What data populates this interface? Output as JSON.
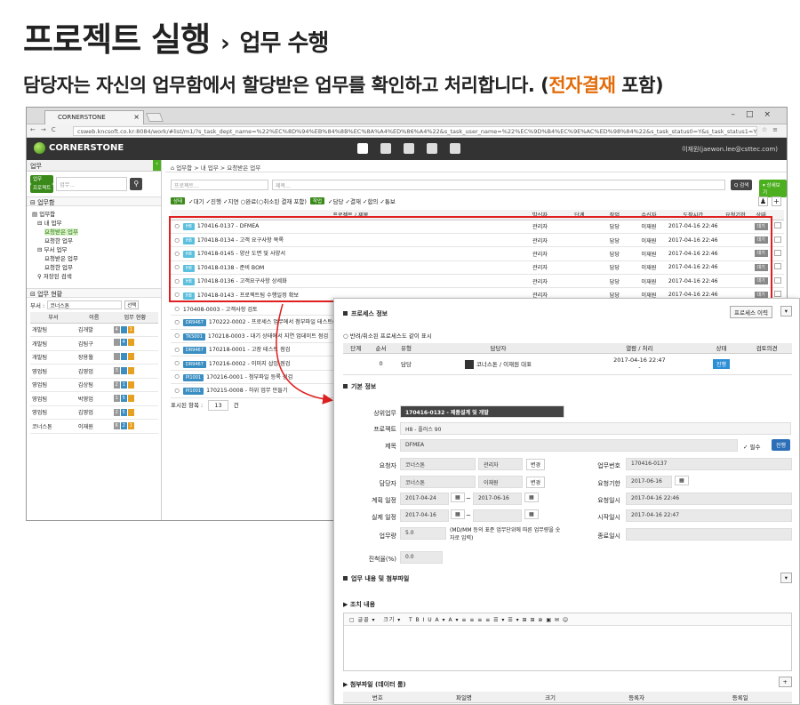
{
  "header": {
    "title": "프로젝트 실행",
    "title_sep": "›",
    "subtitle": "업무 수행",
    "desc_main": "담당자는 자신의 업무함에서 할당받은 업무를 확인하고 처리합니다. (",
    "desc_accent": "전자결재",
    "desc_end": " 포함)",
    "accent_color": "#e36c09"
  },
  "browser": {
    "tab_title": "CORNERSTONE",
    "url": "csweb.kncsoft.co.kr:8084/work/#list/m1/?s_task_dept_name=%22%EC%8D%94%EB%84%8B%EC%8A%A4%ED%86%A4%22&s_task_user_name=%22%EC%9D%B4%EC%9E%AC%ED%98%84%22&s_task_status0=Y&s_task_status1=Y&s_task_status2=Y&s_task_type0=Y&s_tas"
  },
  "app": {
    "logo_text": "CORNERSTONE",
    "user": "이재원(jaewon.lee@csttec.com)"
  },
  "left": {
    "header": "업무",
    "search_tag1": "업무",
    "search_tag2": "프로젝트",
    "search_placeholder": "업무...",
    "box_title": "업무함",
    "tree": [
      "업무함",
      "내 업무",
      "요청받은 업무",
      "요청한 업무",
      "부서 업무",
      "요청받은 업무",
      "요청한 업무",
      "저장된 검색"
    ],
    "status_title": "업무 현황",
    "dept_label": "부서 :",
    "dept_value": "코너스톤",
    "dept_btn": "선택",
    "cols": [
      "부서",
      "이름",
      "업무 현황"
    ],
    "rows": [
      {
        "dept": "개발팀",
        "name": "김개발",
        "a": "4",
        "b": "",
        "c": "1"
      },
      {
        "dept": "개발팀",
        "name": "김팀구",
        "a": "",
        "b": "4",
        "c": ""
      },
      {
        "dept": "개발팀",
        "name": "장용월",
        "a": "",
        "b": "",
        "c": ""
      },
      {
        "dept": "영업팀",
        "name": "김영업",
        "a": "3",
        "b": "",
        "c": ""
      },
      {
        "dept": "영업팀",
        "name": "김상팀",
        "a": "2",
        "b": "1",
        "c": ""
      },
      {
        "dept": "영업팀",
        "name": "박영업",
        "a": "1",
        "b": "5",
        "c": ""
      },
      {
        "dept": "영업팀",
        "name": "김영업",
        "a": "2",
        "b": "5",
        "c": ""
      },
      {
        "dept": "코너스톤",
        "name": "이재원",
        "a": "6",
        "b": "2",
        "c": "1"
      }
    ]
  },
  "main": {
    "breadcrumb": "⌂ 업무함 > 내 업무 > 요청받은 업무",
    "project_placeholder": "프로젝트...",
    "task_placeholder": "제목...",
    "search_btn": "Q 검색",
    "adv_btn": "▾ 상세보기",
    "status_tag": "상태",
    "status_items": "✓대기 ✓진행 ✓지연 ○완료(○취소된 결재 포함)",
    "type_tag": "작업",
    "type_items": "✓담당 ✓결재 ✓합의 ✓통보",
    "cols": [
      "",
      "프로젝트 / 제목",
      "발신자",
      "단계",
      "작업",
      "수신자",
      "도착시간",
      "요청기한",
      "상태",
      ""
    ],
    "rows": [
      {
        "badge": "H8",
        "btype": "h8",
        "title": "170416-0137 - DFMEA",
        "sender": "관리자",
        "work": "담당",
        "recv": "이재원",
        "time": "2017-04-16 22:46",
        "state": "대기"
      },
      {
        "badge": "H8",
        "btype": "h8",
        "title": "170418-0134 - 고객 요구사항 목록",
        "sender": "관리자",
        "work": "담당",
        "recv": "이재원",
        "time": "2017-04-16 22:46",
        "state": "대기"
      },
      {
        "badge": "H8",
        "btype": "h8",
        "title": "170418-0145 - 양산 도면 및 사양서",
        "sender": "관리자",
        "work": "담당",
        "recv": "이재원",
        "time": "2017-04-16 22:46",
        "state": "대기"
      },
      {
        "badge": "H8",
        "btype": "h8",
        "title": "170418-0138 - 준비 BOM",
        "sender": "관리자",
        "work": "담당",
        "recv": "이재원",
        "time": "2017-04-16 22:46",
        "state": "대기"
      },
      {
        "badge": "H8",
        "btype": "h8",
        "title": "170418-0136 - 고객요구사항 상세화",
        "sender": "관리자",
        "work": "담당",
        "recv": "이재원",
        "time": "2017-04-16 22:46",
        "state": "대기"
      },
      {
        "badge": "H8",
        "btype": "h8",
        "title": "170418-0143 - 프로젝트팀 수행일정 확보",
        "sender": "관리자",
        "work": "담당",
        "recv": "이재원",
        "time": "2017-04-16 22:46",
        "state": "대기"
      },
      {
        "badge": "",
        "btype": "",
        "title": "170408-0003 - 고객사항 검토",
        "sender": "",
        "work": "",
        "recv": "",
        "time": "",
        "state": ""
      },
      {
        "badge": "DR9467",
        "btype": "dr",
        "title": "170222-0002 - 프로세스 업무에서 첨부파일 테스트(고객사",
        "sender": "",
        "work": "",
        "recv": "",
        "time": "",
        "state": ""
      },
      {
        "badge": "TKS001",
        "btype": "tk",
        "title": "170218-0003 - 대기 상태에서 지연 업데이트 점검",
        "sender": "",
        "work": "",
        "recv": "",
        "time": "",
        "state": ""
      },
      {
        "badge": "DR9467",
        "btype": "dr",
        "title": "170218-0001 - 고장 테스트 점검",
        "sender": "",
        "work": "",
        "recv": "",
        "time": "",
        "state": ""
      },
      {
        "badge": "DR9467",
        "btype": "dr",
        "title": "170216-0002 - 이미지 삽입 점검",
        "sender": "",
        "work": "",
        "recv": "",
        "time": "",
        "state": ""
      },
      {
        "badge": "PI1001",
        "btype": "pt",
        "title": "170216-0001 - 첨부파일 등록 점검",
        "sender": "",
        "work": "",
        "recv": "",
        "time": "",
        "state": ""
      },
      {
        "badge": "PI1001",
        "btype": "pt",
        "title": "170215-0008 - 하위 업무 만들기",
        "sender": "",
        "work": "",
        "recv": "",
        "time": "",
        "state": ""
      }
    ],
    "pager_label": "표시된 항목 :",
    "pager_value": "13",
    "pager_unit": "건"
  },
  "popup": {
    "process_title": "프로세스 정보",
    "process_btn": "프로세스 이력",
    "show_cancel": "반려/취소된 프로세스도 같이 표시",
    "proc_cols": [
      "단계",
      "순서",
      "유형",
      "담당자",
      "열람 / 처리",
      "상태",
      "검토의견"
    ],
    "proc_row": {
      "step": "",
      "order": "0",
      "type": "담당",
      "user": "코너스톤 / 이재원 대표",
      "time": "2017-04-16 22:47",
      "time2": "-",
      "status": "진행"
    },
    "basic_title": "기본 정보",
    "parent_label": "상위업무",
    "parent_value": "170416-0132 - 제품설계 및 개발",
    "project_label": "프로젝트",
    "project_value": "H8 - 플러스 90",
    "title_label": "제목",
    "title_value": "DFMEA",
    "required": "✓ 필수",
    "progress_btn": "진행",
    "requester_label": "요청자",
    "requester_value": "코너스톤",
    "requester_role": "관리자",
    "change_btn": "변경",
    "assignee_label": "담당자",
    "assignee_value": "코너스톤",
    "assignee_name": "이재원",
    "tasknum_label": "업무번호",
    "tasknum_value": "170416-0137",
    "deadline_label": "요청기한",
    "deadline_value": "2017-06-16",
    "plan_label": "계획 일정",
    "plan_start": "2017-04-24",
    "plan_end": "2017-06-16",
    "req_time_label": "요청일시",
    "req_time_value": "2017-04-16 22:46",
    "actual_label": "실제 일정",
    "actual_start": "2017-04-16",
    "actual_end": "",
    "start_time_label": "시작일시",
    "start_time_value": "2017-04-16 22:47",
    "workload_label": "업무량",
    "workload_value": "5.0",
    "workload_hint": "(MD/MM 등의 표준 업무단위에 따른 업무량을 숫자로 입력)",
    "end_time_label": "종료일시",
    "progress_label": "진척율(%)",
    "progress_value": "0.0",
    "content_title": "업무 내용 및 첨부파일",
    "action_title": "조치 내용",
    "editor_font": "글꼴",
    "editor_size": "크기",
    "attach_title": "첨부파일 (데이터 룸)",
    "attach_cols": [
      "번호",
      "파일명",
      "크기",
      "등록자",
      "등록일"
    ]
  }
}
